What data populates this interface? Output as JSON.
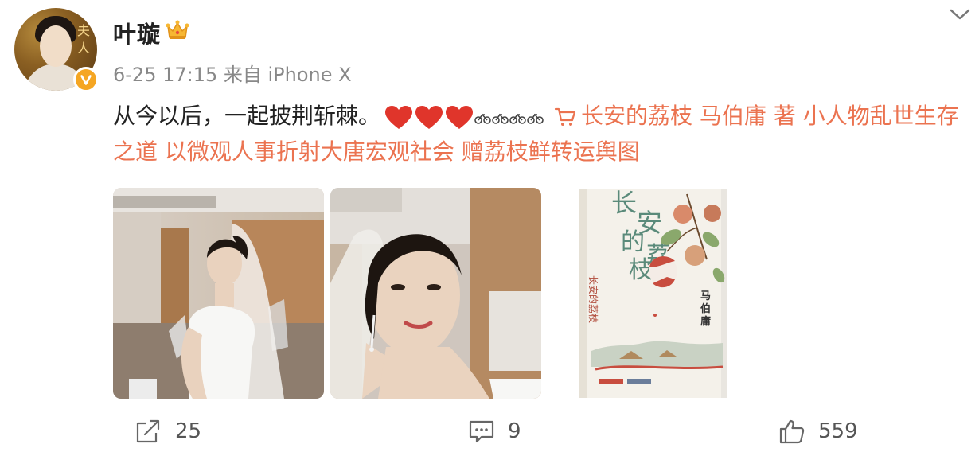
{
  "user": {
    "name": "叶璇",
    "meta": "6-25 17:15  来自 iPhone X",
    "avatar_badge": "crown-icon",
    "verified": "verified-badge-icon"
  },
  "post": {
    "text_main": "从今以后，一起披荆斩棘。",
    "emoji": [
      "heart-icon",
      "heart-icon",
      "heart-icon"
    ],
    "sticker": "bicycle-stickers-icon",
    "link_icon": "shopping-cart-icon",
    "link_text": "长安的荔枝 马伯庸 著 小人物乱世生存之道 以微观人事折射大唐宏观社会 赠荔枝鲜转运舆图"
  },
  "images": [
    {
      "name": "bride-photo-1"
    },
    {
      "name": "bride-photo-2"
    },
    {
      "name": "book-cover",
      "title": "长安的荔枝",
      "author": "马伯庸"
    }
  ],
  "actions": {
    "repost_count": "25",
    "comment_count": "9",
    "like_count": "559"
  },
  "colors": {
    "link": "#eb7350",
    "verified": "#f5a623",
    "heart": "#e0352b"
  }
}
